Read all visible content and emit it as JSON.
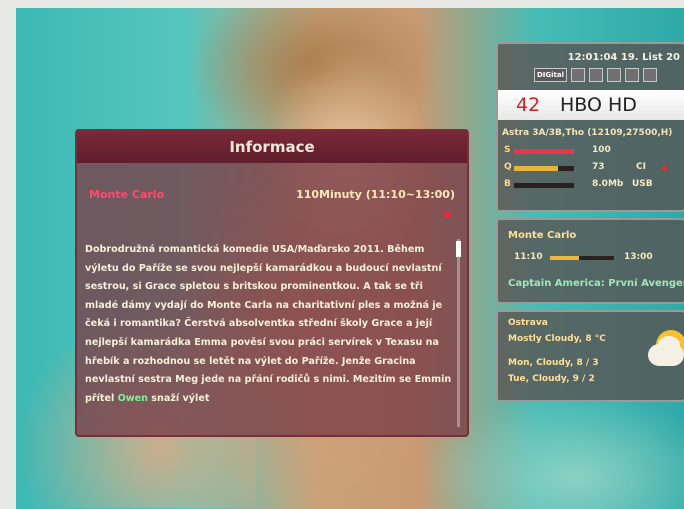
{
  "info": {
    "header": "Informace",
    "program_title": "Monte Carlo",
    "duration_time": "110Minuty (11:10~13:00)",
    "desc_before": "Dobrodružná romantická komedie USA/Maďarsko 2011. Během výletu do Paříže se svou nejlepší kamarádkou a budoucí nevlastní sestrou, si Grace spletou s britskou prominentkou. A tak se tři mladé dámy vydají do Monte Carla na charitativní ples a možná je čeká i romantika? Čerstvá absolventka střední školy Grace a její nejlepší kamarádka Emma pověsí svou práci servírek v Texasu na hřebík a rozhodnou se letět na výlet do Paříže. Jenže Gracina nevlastní sestra Meg jede na přání rodičů s nimi. Mezitím se Emmin přítel ",
    "desc_highlight": "Owen",
    "desc_after": " snaží výlet"
  },
  "channel": {
    "clock": "12:01:04  19. List 20",
    "badge_digital": "DIGital",
    "number": "42",
    "name": "HBO HD",
    "satellite": "Astra 3A/3B,Tho (12109,27500,H)",
    "meters": [
      {
        "label": "S",
        "value": "100",
        "level": 1.0,
        "color": "#e8364a"
      },
      {
        "label": "Q",
        "value": "73",
        "level": 0.73,
        "color": "#e8b43a"
      },
      {
        "label": "B",
        "value": "8.0Mb",
        "level": 0.0,
        "color": "#cccccc"
      }
    ],
    "ci_label": "CI",
    "usb_label": "USB"
  },
  "epg": {
    "current": "Monte Carlo",
    "start": "11:10",
    "end": "13:00",
    "progress": 0.45,
    "next": "Captain America: První Avenger"
  },
  "weather": {
    "city": "Ostrava",
    "now": "Mostly Cloudy, 8 °C",
    "day1": "Mon, Cloudy, 8 / 3",
    "day2": "Tue, Cloudy, 9 / 2",
    "icon": "partly-cloudy-icon"
  }
}
